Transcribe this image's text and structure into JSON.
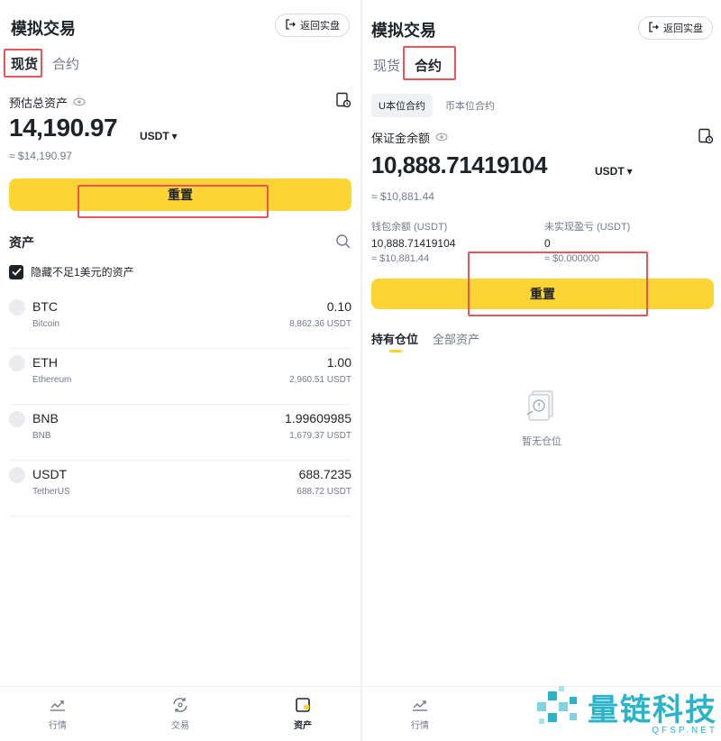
{
  "left": {
    "title": "模拟交易",
    "back_label": "返回实盘",
    "tabs": [
      "现货",
      "合约"
    ],
    "estimate_label": "预估总资产",
    "total": "14,190.97",
    "unit": "USDT",
    "approx": "≈ $14,190.97",
    "reset": "重置",
    "assets_title": "资产",
    "hide_small": "隐藏不足1美元的资产",
    "assets": [
      {
        "symbol": "BTC",
        "name": "Bitcoin",
        "amount": "0.10",
        "usd": "8,862.36 USDT"
      },
      {
        "symbol": "ETH",
        "name": "Ethereum",
        "amount": "1.00",
        "usd": "2,960.51 USDT"
      },
      {
        "symbol": "BNB",
        "name": "BNB",
        "amount": "1.99609985",
        "usd": "1,679.37 USDT"
      },
      {
        "symbol": "USDT",
        "name": "TetherUS",
        "amount": "688.7235",
        "usd": "688.72 USDT"
      }
    ],
    "nav": [
      "行情",
      "交易",
      "资产"
    ]
  },
  "right": {
    "title": "模拟交易",
    "back_label": "返回实盘",
    "tabs": [
      "现货",
      "合约"
    ],
    "subtabs": [
      "U本位合约",
      "币本位合约"
    ],
    "margin_label": "保证金余额",
    "margin": "10,888.71419104",
    "unit": "USDT",
    "approx": "≈ $10,881.44",
    "wallet_label": "钱包余额 (USDT)",
    "wallet_value": "10,888.71419104",
    "wallet_approx": "≈ $10,881.44",
    "pnl_label": "未实现盈亏 (USDT)",
    "pnl_value": "0",
    "pnl_approx": "≈ $0.000000",
    "reset": "重置",
    "holding_tabs": [
      "持有仓位",
      "全部资产"
    ],
    "empty_text": "暂无仓位",
    "nav": [
      "行情"
    ]
  },
  "watermark": {
    "text": "量链科技",
    "sub": "QFSP.NET"
  },
  "colors": {
    "accent": "#fcd535",
    "highlight": "#e8555a",
    "muted": "#707a8a",
    "watermark": "#2bb3c9"
  }
}
